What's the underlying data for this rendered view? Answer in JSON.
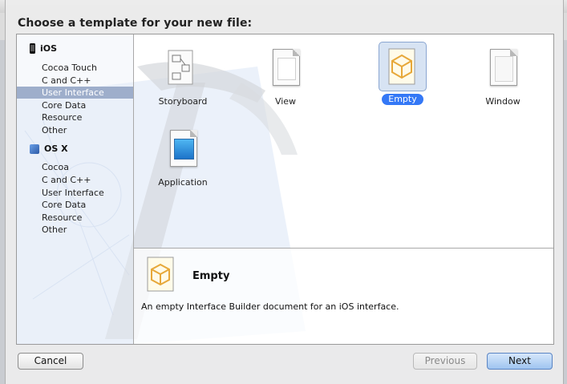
{
  "dialog": {
    "title": "Choose a template for your new file:"
  },
  "sidebar": {
    "groups": [
      {
        "label": "iOS",
        "icon": "ios-device-icon",
        "items": [
          "Cocoa Touch",
          "C and C++",
          "User Interface",
          "Core Data",
          "Resource",
          "Other"
        ],
        "selected": "User Interface"
      },
      {
        "label": "OS X",
        "icon": "osx-icon",
        "items": [
          "Cocoa",
          "C and C++",
          "User Interface",
          "Core Data",
          "Resource",
          "Other"
        ]
      }
    ]
  },
  "templates": [
    {
      "label": "Storyboard",
      "icon": "storyboard-icon"
    },
    {
      "label": "View",
      "icon": "view-icon"
    },
    {
      "label": "Empty",
      "icon": "empty-icon",
      "selected": true
    },
    {
      "label": "Window",
      "icon": "window-icon"
    },
    {
      "label": "Application",
      "icon": "application-icon"
    }
  ],
  "detail": {
    "title": "Empty",
    "description": "An empty Interface Builder document for an iOS interface."
  },
  "buttons": {
    "cancel": "Cancel",
    "previous": "Previous",
    "next": "Next"
  },
  "colors": {
    "selection": "#3478f6",
    "sidebar_selection": "#9eaecb",
    "accent_cube": "#e7a83a"
  }
}
